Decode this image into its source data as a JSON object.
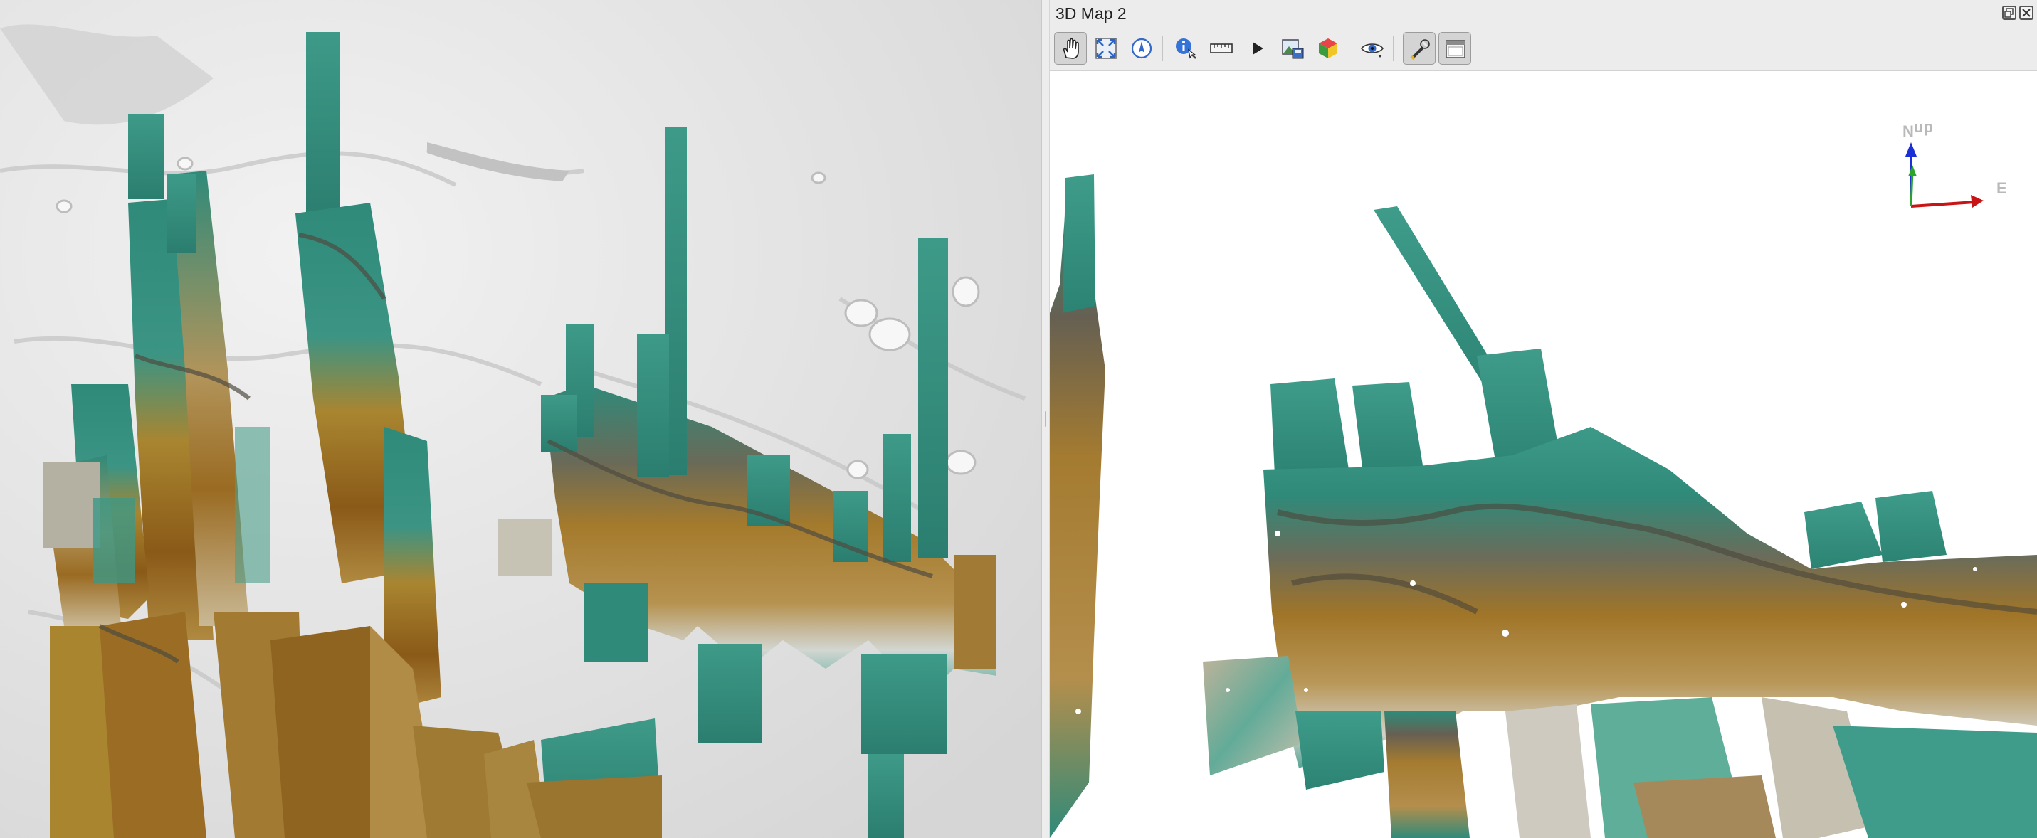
{
  "panel_3d": {
    "title": "3D Map 2",
    "axis_labels": {
      "north": "N",
      "up": "up",
      "east": "E"
    }
  },
  "toolbar_3d": {
    "tools": [
      {
        "name": "pan-tool",
        "icon": "hand-icon",
        "active": true
      },
      {
        "name": "zoom-full-tool",
        "icon": "zoom-full-icon",
        "active": false
      },
      {
        "name": "camera-control-tool",
        "icon": "compass-icon",
        "active": false
      },
      {
        "name": "identify-tool",
        "icon": "identify-icon",
        "active": false
      },
      {
        "name": "measure-tool",
        "icon": "ruler-icon",
        "active": false
      },
      {
        "name": "animations-tool",
        "icon": "play-icon",
        "active": false
      },
      {
        "name": "save-image-tool",
        "icon": "export-image-icon",
        "active": false
      },
      {
        "name": "export-3d-tool",
        "icon": "cube-icon",
        "active": false
      },
      {
        "name": "camera-menu-tool",
        "icon": "eye-icon",
        "active": false
      },
      {
        "name": "configure-tool",
        "icon": "wrench-icon",
        "active": true
      },
      {
        "name": "toggle-panel-tool",
        "icon": "panel-icon",
        "active": true
      }
    ]
  },
  "colors": {
    "hillshade": "#e3e3e3",
    "dem_low": "#2f8a7a",
    "dem_mid": "#a98530",
    "dem_high": "#8a5a18",
    "axis_north": "#1a2fd6",
    "axis_east": "#c81414",
    "axis_up": "#2aa52a"
  }
}
